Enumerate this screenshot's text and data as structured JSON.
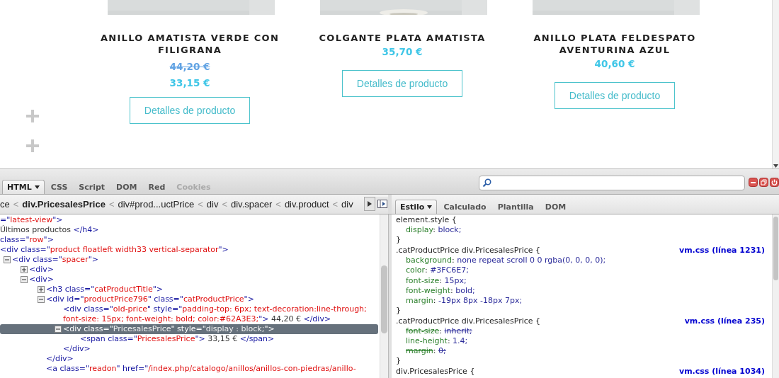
{
  "products": [
    {
      "title": "ANILLO AMATISTA VERDE CON FILIGRANA",
      "old_price": "44,20 €",
      "price": "33,15 €",
      "button": "Detalles de producto"
    },
    {
      "title": "COLGANTE PLATA AMATISTA",
      "price": "35,70 €",
      "button": "Detalles de producto"
    },
    {
      "title": "ANILLO PLATA FELDESPATO AVENTURINA AZUL",
      "price": "40,60 €",
      "button": "Detalles de producto"
    }
  ],
  "devtools": {
    "tabs": [
      {
        "label": "HTML",
        "selected": true,
        "disabled": false,
        "menu": true
      },
      {
        "label": "CSS",
        "selected": false,
        "disabled": false,
        "menu": false
      },
      {
        "label": "Script",
        "selected": false,
        "disabled": false,
        "menu": false
      },
      {
        "label": "DOM",
        "selected": false,
        "disabled": false,
        "menu": false
      },
      {
        "label": "Red",
        "selected": false,
        "disabled": false,
        "menu": false
      },
      {
        "label": "Cookies",
        "selected": false,
        "disabled": true,
        "menu": false
      }
    ],
    "breadcrumb": {
      "separator": "<",
      "items": [
        {
          "label": "ce",
          "selected": false
        },
        {
          "label": "div.PricesalesPrice",
          "selected": true
        },
        {
          "label": "div#prod...uctPrice",
          "selected": false
        },
        {
          "label": "div",
          "selected": false
        },
        {
          "label": "div.spacer",
          "selected": false
        },
        {
          "label": "div.product",
          "selected": false
        },
        {
          "label": "div",
          "selected": false
        }
      ]
    },
    "html_tree": [
      {
        "selected": false,
        "segments": [
          {
            "kind": "tag",
            "text": "=\""
          },
          {
            "kind": "value",
            "text": "latest-view"
          },
          {
            "kind": "tag",
            "text": "\">"
          }
        ]
      },
      {
        "selected": false,
        "segments": [
          {
            "kind": "text",
            "text": " Últimos productos "
          },
          {
            "kind": "tag",
            "text": "</h4>"
          }
        ]
      },
      {
        "selected": false,
        "segments": [
          {
            "kind": "attr",
            "text": "class=\""
          },
          {
            "kind": "value",
            "text": "row"
          },
          {
            "kind": "tag",
            "text": "\">"
          }
        ]
      },
      {
        "selected": false,
        "segments": [
          {
            "kind": "tag",
            "text": "<div "
          },
          {
            "kind": "attr",
            "text": "class=\""
          },
          {
            "kind": "value",
            "text": "product floatleft width33 vertical-separator"
          },
          {
            "kind": "tag",
            "text": "\">"
          }
        ],
        "children": [
          {
            "selected": false,
            "expanded": true,
            "segments": [
              {
                "kind": "tag",
                "text": "<div "
              },
              {
                "kind": "attr",
                "text": "class=\""
              },
              {
                "kind": "value",
                "text": "spacer"
              },
              {
                "kind": "tag",
                "text": "\">"
              }
            ],
            "children": [
              {
                "selected": false,
                "expanded": false,
                "segments": [
                  {
                    "kind": "tag",
                    "text": "<div>"
                  }
                ]
              },
              {
                "selected": false,
                "expanded": true,
                "segments": [
                  {
                    "kind": "tag",
                    "text": "<div>"
                  }
                ],
                "children": [
                  {
                    "selected": false,
                    "expanded": false,
                    "segments": [
                      {
                        "kind": "tag",
                        "text": "<h3 "
                      },
                      {
                        "kind": "attr",
                        "text": "class=\""
                      },
                      {
                        "kind": "value",
                        "text": "catProductTitle"
                      },
                      {
                        "kind": "tag",
                        "text": "\">"
                      }
                    ]
                  },
                  {
                    "selected": false,
                    "expanded": true,
                    "segments": [
                      {
                        "kind": "tag",
                        "text": "<div "
                      },
                      {
                        "kind": "attr",
                        "text": "id=\""
                      },
                      {
                        "kind": "value",
                        "text": "productPrice796"
                      },
                      {
                        "kind": "attr",
                        "text": "\" class=\""
                      },
                      {
                        "kind": "value",
                        "text": "catProductPrice"
                      },
                      {
                        "kind": "tag",
                        "text": "\">"
                      }
                    ],
                    "children": [
                      {
                        "selected": false,
                        "segments": [
                          {
                            "kind": "tag",
                            "text": "<div "
                          },
                          {
                            "kind": "attr",
                            "text": "class=\""
                          },
                          {
                            "kind": "value",
                            "text": "old-price"
                          },
                          {
                            "kind": "attr",
                            "text": "\" style=\""
                          },
                          {
                            "kind": "value",
                            "text": "padding-top: 6px; text-decoration:line-through; font-size: 15px; font-weight: bold; color:#62A3E3;"
                          },
                          {
                            "kind": "tag",
                            "text": "\">"
                          },
                          {
                            "kind": "text",
                            "text": " 44,20 € "
                          },
                          {
                            "kind": "tag",
                            "text": "</div>"
                          }
                        ]
                      },
                      {
                        "selected": true,
                        "expanded": true,
                        "segments": [
                          {
                            "kind": "tag",
                            "text": "<div "
                          },
                          {
                            "kind": "attr",
                            "text": "class=\""
                          },
                          {
                            "kind": "value",
                            "text": "PricesalesPrice"
                          },
                          {
                            "kind": "attr",
                            "text": "\" style=\""
                          },
                          {
                            "kind": "value",
                            "text": "display : block;"
                          },
                          {
                            "kind": "tag",
                            "text": "\">"
                          }
                        ],
                        "children": [
                          {
                            "selected": false,
                            "segments": [
                              {
                                "kind": "tag",
                                "text": "<span "
                              },
                              {
                                "kind": "attr",
                                "text": "class=\""
                              },
                              {
                                "kind": "value",
                                "text": "PricesalesPrice"
                              },
                              {
                                "kind": "tag",
                                "text": "\">"
                              },
                              {
                                "kind": "text",
                                "text": " 33,15 € "
                              },
                              {
                                "kind": "tag",
                                "text": "</span>"
                              }
                            ]
                          }
                        ]
                      },
                      {
                        "selected": false,
                        "segments": [
                          {
                            "kind": "tag",
                            "text": "</div>"
                          }
                        ]
                      }
                    ]
                  },
                  {
                    "selected": false,
                    "segments": [
                      {
                        "kind": "tag",
                        "text": "</div>"
                      }
                    ]
                  },
                  {
                    "selected": false,
                    "segments": [
                      {
                        "kind": "tag",
                        "text": "<a "
                      },
                      {
                        "kind": "attr",
                        "text": "class=\""
                      },
                      {
                        "kind": "value",
                        "text": "readon"
                      },
                      {
                        "kind": "attr",
                        "text": "\" href=\""
                      },
                      {
                        "kind": "value",
                        "text": "/index.php/catalogo/anillos/anillos-con-piedras/anillo-"
                      }
                    ]
                  }
                ]
              }
            ]
          }
        ]
      }
    ],
    "side_tabs": [
      {
        "label": "Estilo",
        "selected": true,
        "menu": true
      },
      {
        "label": "Calculado",
        "selected": false,
        "menu": false
      },
      {
        "label": "Plantilla",
        "selected": false,
        "menu": false
      },
      {
        "label": "DOM",
        "selected": false,
        "menu": false
      }
    ],
    "css_rules": [
      {
        "selector": "element.style {",
        "close": "}",
        "declarations": [
          {
            "property": "display",
            "value": "block;",
            "overridden": false,
            "colon": ":"
          }
        ]
      },
      {
        "selector": ".catProductPrice div.PricesalesPrice {",
        "source": "vm.css (línea 1231)",
        "close": "}",
        "declarations": [
          {
            "property": "background",
            "value": "none repeat scroll 0 0 rgba(0, 0, 0, 0);",
            "overridden": false,
            "colon": ":"
          },
          {
            "property": "color",
            "value": "#3FC6E7;",
            "overridden": false,
            "colon": ":"
          },
          {
            "property": "font-size",
            "value": "15px;",
            "overridden": false,
            "colon": ":"
          },
          {
            "property": "font-weight",
            "value": "bold;",
            "overridden": false,
            "colon": ":"
          },
          {
            "property": "margin",
            "value": "-19px 8px -18px 7px;",
            "overridden": false,
            "colon": ":"
          }
        ]
      },
      {
        "selector": ".catProductPrice div.PricesalesPrice {",
        "source": "vm.css (línea 235)",
        "close": "}",
        "declarations": [
          {
            "property": "font-size",
            "value": "inherit;",
            "overridden": true,
            "colon": ":"
          },
          {
            "property": "line-height",
            "value": "1.4;",
            "overridden": false,
            "colon": ":"
          },
          {
            "property": "margin",
            "value": "0;",
            "overridden": true,
            "colon": ":"
          }
        ]
      },
      {
        "selector": "div.PricesalesPrice {",
        "source": "vm.css (línea 1034)"
      }
    ]
  }
}
